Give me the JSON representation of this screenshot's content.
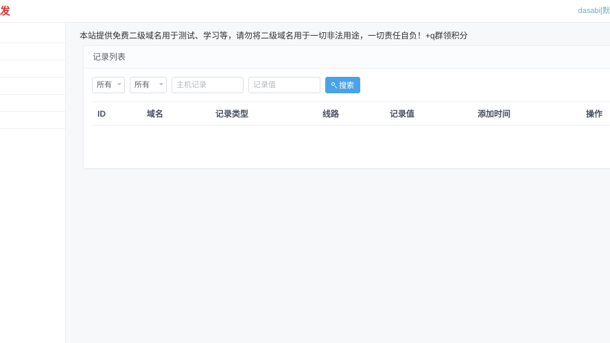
{
  "topbar": {
    "brand": "发",
    "user_name": "dasabi",
    "user_suffix": "[默"
  },
  "sidebar": {
    "items": [
      {
        "label": ""
      },
      {
        "label": ""
      },
      {
        "label": ""
      },
      {
        "label": ""
      },
      {
        "label": ""
      },
      {
        "label": ""
      }
    ]
  },
  "notice": {
    "text": "本站提供免费二级域名用于测试、学习等，请勿将二级域名用于一切非法用途，一切责任自负！+q群领积分"
  },
  "panel": {
    "title": "记录列表"
  },
  "filters": {
    "type_select": {
      "value": "所有"
    },
    "line_select": {
      "value": "所有"
    },
    "host_input": {
      "value": "",
      "placeholder": "主机记录"
    },
    "value_input": {
      "value": "",
      "placeholder": "记录值"
    },
    "search_button": {
      "label": "搜索"
    }
  },
  "table": {
    "columns": [
      {
        "key": "id",
        "label": "ID"
      },
      {
        "key": "domain",
        "label": "域名"
      },
      {
        "key": "type",
        "label": "记录类型"
      },
      {
        "key": "line",
        "label": "线路"
      },
      {
        "key": "value",
        "label": "记录值"
      },
      {
        "key": "time",
        "label": "添加时间"
      },
      {
        "key": "ops",
        "label": "操作"
      }
    ],
    "rows": []
  },
  "colors": {
    "accent": "#4aa3e8",
    "brand_red": "#e03030",
    "link_teal": "#6faec4",
    "page_bg": "#f7f8fa",
    "border": "#ebeef5"
  }
}
